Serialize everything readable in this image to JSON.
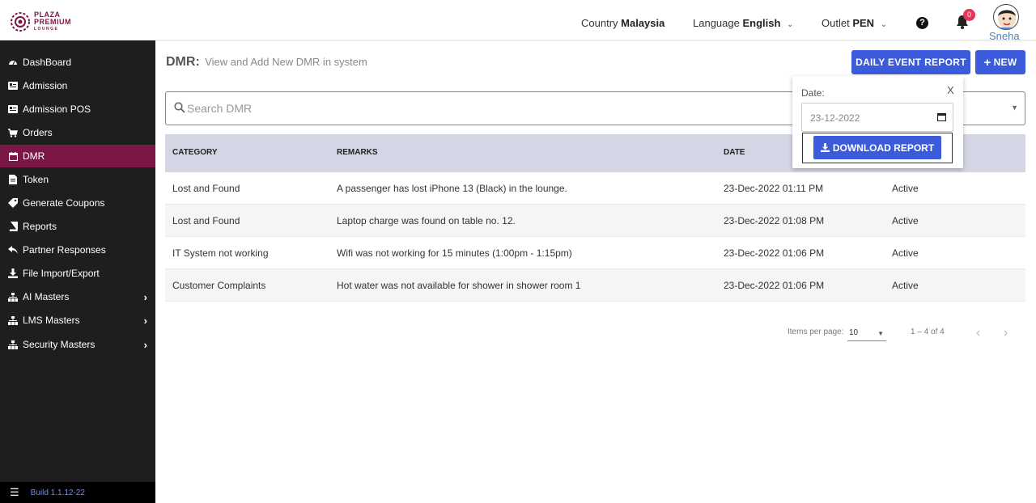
{
  "brand": {
    "line1": "PLAZA",
    "line2": "PREMIUM",
    "line3": "LOUNGE"
  },
  "header": {
    "country_label": "Country",
    "country_value": "Malaysia",
    "language_label": "Language",
    "language_value": "English",
    "outlet_label": "Outlet",
    "outlet_value": "PEN",
    "notification_count": "0",
    "user_name": "Sneha"
  },
  "sidebar": {
    "items": [
      {
        "label": "DashBoard",
        "icon": "dashboard-icon"
      },
      {
        "label": "Admission",
        "icon": "id-card-icon"
      },
      {
        "label": "Admission POS",
        "icon": "id-card-icon"
      },
      {
        "label": "Orders",
        "icon": "cart-icon"
      },
      {
        "label": "DMR",
        "icon": "calendar-icon",
        "active": true
      },
      {
        "label": "Token",
        "icon": "file-icon"
      },
      {
        "label": "Generate Coupons",
        "icon": "tag-icon"
      },
      {
        "label": "Reports",
        "icon": "book-icon"
      },
      {
        "label": "Partner Responses",
        "icon": "reply-icon"
      },
      {
        "label": "File Import/Export",
        "icon": "download-icon"
      },
      {
        "label": "AI Masters",
        "icon": "sitemap-icon",
        "expandable": true
      },
      {
        "label": "LMS Masters",
        "icon": "sitemap-icon",
        "expandable": true
      },
      {
        "label": "Security Masters",
        "icon": "sitemap-icon",
        "expandable": true
      }
    ],
    "build": "Build 1.1.12-22"
  },
  "page": {
    "title": "DMR:",
    "subtitle": "View and Add New DMR in system",
    "daily_report_button": "DAILY EVENT REPORT",
    "new_button": "NEW"
  },
  "search": {
    "placeholder": "Search DMR"
  },
  "table": {
    "headers": [
      "CATEGORY",
      "REMARKS",
      "DATE"
    ],
    "rows": [
      {
        "category": "Lost and Found",
        "remarks": "A passenger has lost iPhone 13 (Black) in the lounge.",
        "date": "23-Dec-2022 01:11 PM",
        "status": "Active"
      },
      {
        "category": "Lost and Found",
        "remarks": "Laptop charge was found on table no. 12.",
        "date": "23-Dec-2022 01:08 PM",
        "status": "Active"
      },
      {
        "category": "IT System not working",
        "remarks": "Wifi was not working for 15 minutes (1:00pm - 1:15pm)",
        "date": "23-Dec-2022 01:06 PM",
        "status": "Active"
      },
      {
        "category": "Customer Complaints",
        "remarks": "Hot water was not available for shower in shower room 1",
        "date": "23-Dec-2022 01:06 PM",
        "status": "Active"
      }
    ]
  },
  "pagination": {
    "items_per_page_label": "Items per page:",
    "items_per_page_value": "10",
    "range": "1 – 4 of 4"
  },
  "popover": {
    "date_label": "Date:",
    "close": "X",
    "date_value": "23-12-2022",
    "download_button": "DOWNLOAD REPORT"
  },
  "colors": {
    "accent": "#3b5bdb",
    "brand": "#7a1747",
    "sidebar": "#1e1e1e"
  }
}
